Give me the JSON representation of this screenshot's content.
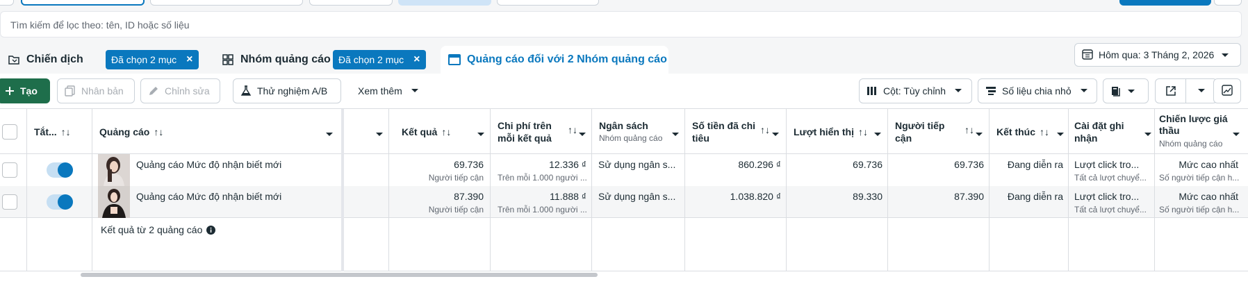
{
  "search": {
    "placeholder": "Tìm kiếm để lọc theo: tên, ID hoặc số liệu"
  },
  "tabs": {
    "campaign": {
      "label": "Chiến dịch",
      "chip": "Đã chọn 2 mục"
    },
    "adset": {
      "label": "Nhóm quảng cáo",
      "chip": "Đã chọn 2 mục"
    },
    "ads": {
      "label": "Quảng cáo đối với 2 Nhóm quảng cáo"
    }
  },
  "date_range": {
    "label": "Hôm qua: 3 Tháng 2, 2026"
  },
  "toolbar": {
    "create": "Tạo",
    "duplicate": "Nhân bản",
    "edit": "Chỉnh sửa",
    "ab_test": "Thử nghiệm A/B",
    "more": "Xem thêm",
    "columns": "Cột: Tùy chỉnh",
    "breakdown": "Số liệu chia nhỏ"
  },
  "columns": {
    "toggle": "Tắt...",
    "ad": "Quảng cáo",
    "result": "Kết quả",
    "cost_per_result": "Chi phí trên mỗi kết quả",
    "budget": "Ngân sách",
    "budget_sub": "Nhóm quảng cáo",
    "amount_spent": "Số tiền đã chi tiêu",
    "impressions": "Lượt hiển thị",
    "reach": "Người tiếp cận",
    "ends": "Kết thúc",
    "attribution": "Cài đặt ghi nhận",
    "bid_strategy": "Chiến lược giá thầu",
    "bid_strategy_sub": "Nhóm quảng cáo"
  },
  "rows": [
    {
      "name": "Quảng cáo Mức độ nhận biết mới",
      "result": "69.736",
      "result_sub": "Người tiếp cận",
      "cost_per_result": "12.336 ₫",
      "cost_sub": "Trên mỗi 1.000 người ...",
      "budget": "Sử dụng ngân s...",
      "amount_spent": "860.296 ₫",
      "impressions": "69.736",
      "reach": "69.736",
      "ends": "Đang diễn ra",
      "attribution": "Lượt click tro...",
      "attribution_sub": "Tất cả lượt chuyể...",
      "bid": "Mức cao nhất",
      "bid_sub": "Số người tiếp cận h..."
    },
    {
      "name": "Quảng cáo Mức độ nhận biết mới",
      "result": "87.390",
      "result_sub": "Người tiếp cận",
      "cost_per_result": "11.888 ₫",
      "cost_sub": "Trên mỗi 1.000 người ...",
      "budget": "Sử dụng ngân s...",
      "amount_spent": "1.038.820 ₫",
      "impressions": "89.330",
      "reach": "87.390",
      "ends": "Đang diễn ra",
      "attribution": "Lượt click tro...",
      "attribution_sub": "Tất cả lượt chuyể...",
      "bid": "Mức cao nhất",
      "bid_sub": "Số người tiếp cận h..."
    }
  ],
  "summary": {
    "label": "Kết quả từ 2 quảng cáo"
  },
  "colors": {
    "accent": "#0a78be",
    "create_green": "#1e6e4b",
    "toggle_track": "#c6dff3"
  }
}
